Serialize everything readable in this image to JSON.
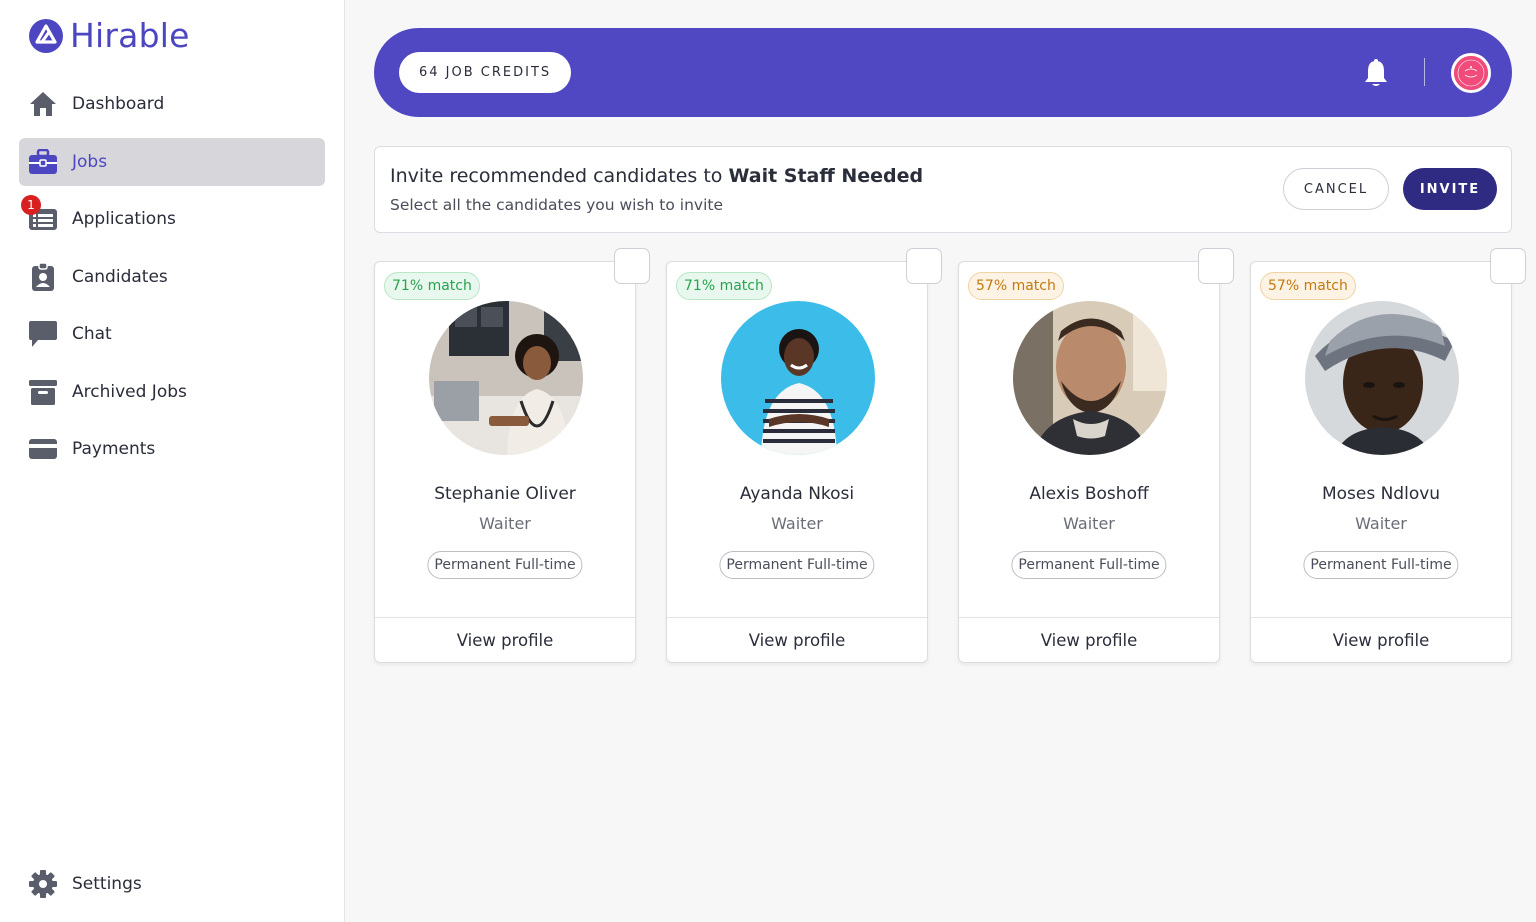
{
  "app": {
    "name": "Hirable",
    "brand_color": "#4d46c1"
  },
  "sidebar": {
    "items": [
      {
        "label": "Dashboard",
        "icon": "home-icon"
      },
      {
        "label": "Jobs",
        "icon": "briefcase-icon",
        "active": true
      },
      {
        "label": "Applications",
        "icon": "applications-icon",
        "badge": "1"
      },
      {
        "label": "Candidates",
        "icon": "id-badge-icon"
      },
      {
        "label": "Chat",
        "icon": "chat-icon"
      },
      {
        "label": "Archived Jobs",
        "icon": "archive-icon"
      },
      {
        "label": "Payments",
        "icon": "credit-card-icon"
      }
    ],
    "settings": {
      "label": "Settings",
      "icon": "gear-icon"
    }
  },
  "header": {
    "credits_label": "64 JOB CREDITS",
    "bar_color": "#5048c2"
  },
  "invite": {
    "title_prefix": "Invite recommended candidates to ",
    "job_name": "Wait Staff Needed",
    "subtitle": "Select all the candidates you wish to invite",
    "cancel_label": "CANCEL",
    "invite_label": "INVITE"
  },
  "candidates": [
    {
      "match": "71% match",
      "match_level": "green",
      "name": "Stephanie Oliver",
      "role": "Waiter",
      "type": "Permanent Full-time",
      "view": "View profile"
    },
    {
      "match": "71% match",
      "match_level": "green",
      "name": "Ayanda Nkosi",
      "role": "Waiter",
      "type": "Permanent Full-time",
      "view": "View profile"
    },
    {
      "match": "57% match",
      "match_level": "orange",
      "name": "Alexis Boshoff",
      "role": "Waiter",
      "type": "Permanent Full-time",
      "view": "View profile"
    },
    {
      "match": "57% match",
      "match_level": "orange",
      "name": "Moses Ndlovu",
      "role": "Waiter",
      "type": "Permanent Full-time",
      "view": "View profile"
    }
  ]
}
